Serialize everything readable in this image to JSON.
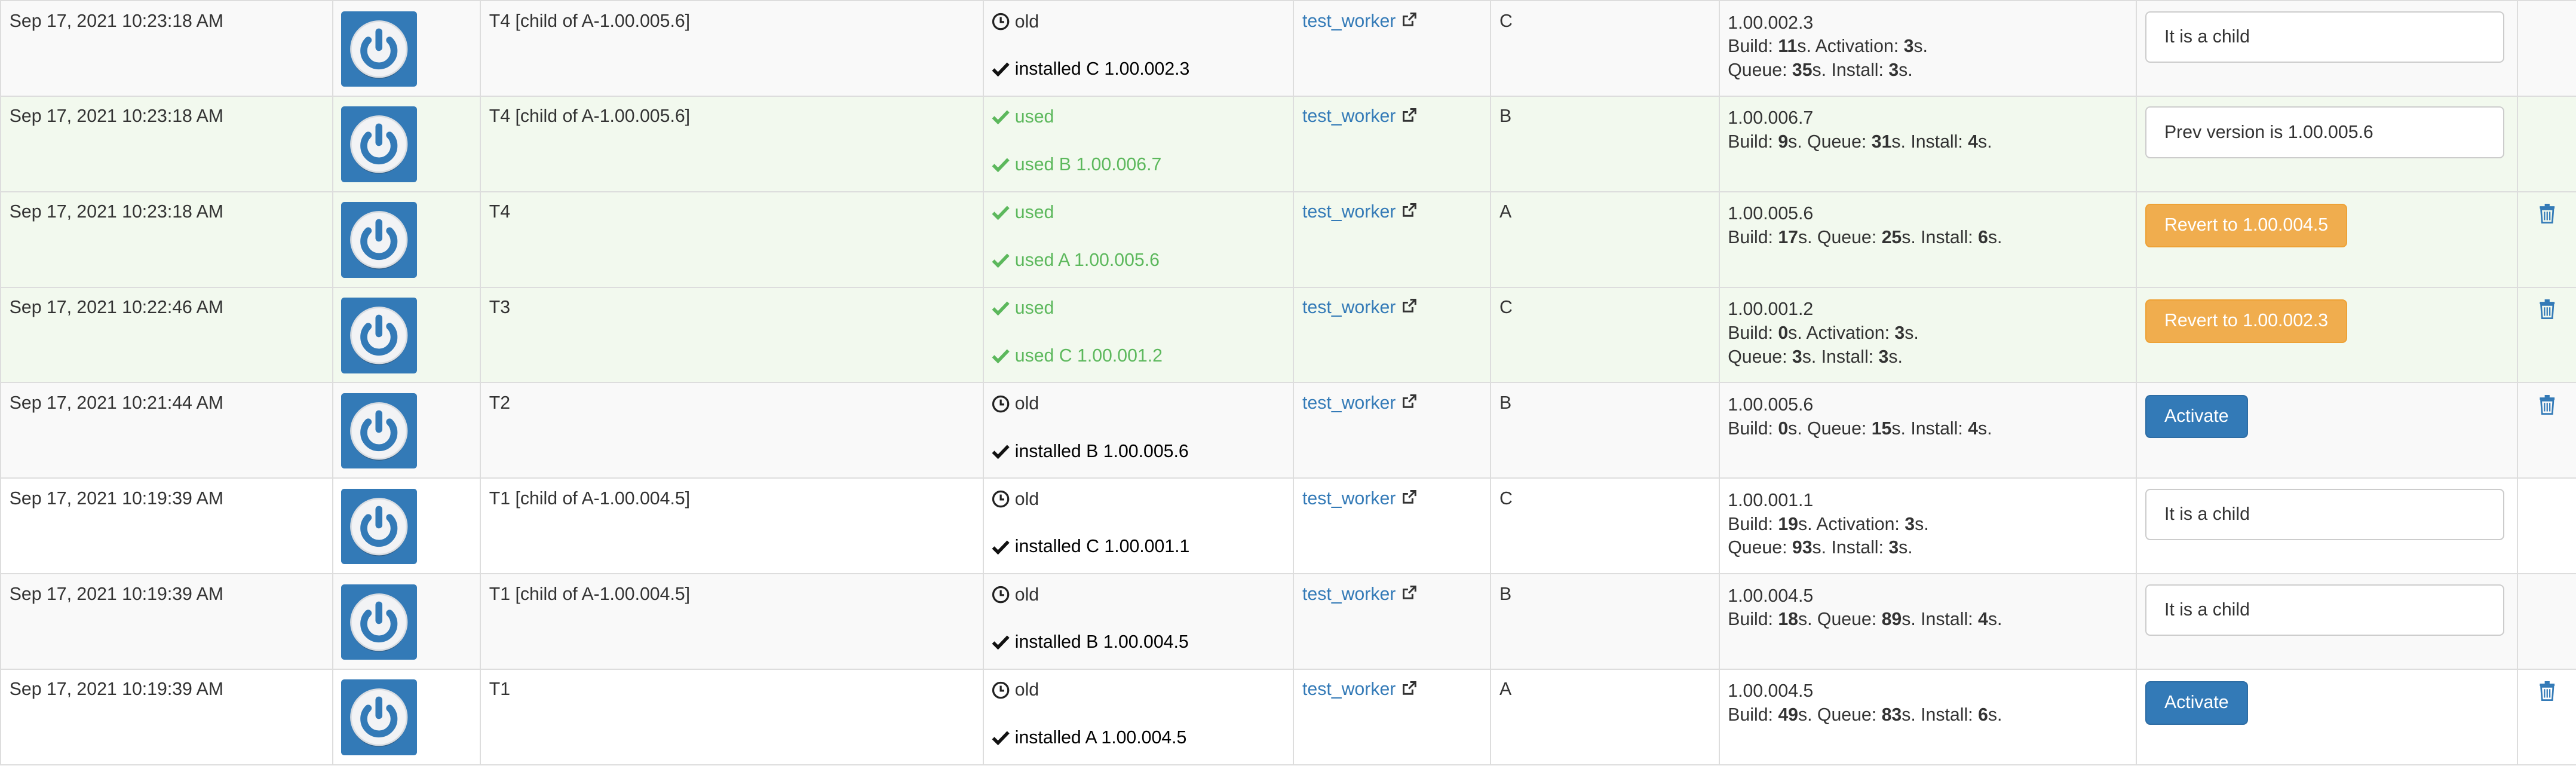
{
  "rows": [
    {
      "date": "Sep 17, 2021 10:23:18 AM",
      "name": "T4 [child of A-1.00.005.6]",
      "state": "old",
      "install_status": "installed C 1.00.002.3",
      "status_kind": "installed",
      "worker": "test_worker",
      "env": "C",
      "version": "1.00.002.3",
      "build": "11",
      "activation": "3",
      "queue": "35",
      "install": "3",
      "has_activation": true,
      "action": {
        "type": "note",
        "text": "It is a child"
      },
      "deletable": false,
      "highlight": "odd"
    },
    {
      "date": "Sep 17, 2021 10:23:18 AM",
      "name": "T4 [child of A-1.00.005.6]",
      "state": "used",
      "install_status": "used B 1.00.006.7",
      "status_kind": "used",
      "worker": "test_worker",
      "env": "B",
      "version": "1.00.006.7",
      "build": "9",
      "queue": "31",
      "install": "4",
      "has_activation": false,
      "action": {
        "type": "note",
        "text": "Prev version is 1.00.005.6"
      },
      "deletable": false,
      "highlight": "success"
    },
    {
      "date": "Sep 17, 2021 10:23:18 AM",
      "name": "T4",
      "state": "used",
      "install_status": "used A 1.00.005.6",
      "status_kind": "used",
      "worker": "test_worker",
      "env": "A",
      "version": "1.00.005.6",
      "build": "17",
      "queue": "25",
      "install": "6",
      "has_activation": false,
      "action": {
        "type": "revert",
        "text": "Revert to 1.00.004.5"
      },
      "deletable": true,
      "highlight": "success"
    },
    {
      "date": "Sep 17, 2021 10:22:46 AM",
      "name": "T3",
      "state": "used",
      "install_status": "used C 1.00.001.2",
      "status_kind": "used",
      "worker": "test_worker",
      "env": "C",
      "version": "1.00.001.2",
      "build": "0",
      "activation": "3",
      "queue": "3",
      "install": "3",
      "has_activation": true,
      "action": {
        "type": "revert",
        "text": "Revert to 1.00.002.3"
      },
      "deletable": true,
      "highlight": "success"
    },
    {
      "date": "Sep 17, 2021 10:21:44 AM",
      "name": "T2",
      "state": "old",
      "install_status": "installed B 1.00.005.6",
      "status_kind": "installed",
      "worker": "test_worker",
      "env": "B",
      "version": "1.00.005.6",
      "build": "0",
      "queue": "15",
      "install": "4",
      "has_activation": false,
      "action": {
        "type": "activate",
        "text": "Activate"
      },
      "deletable": true,
      "highlight": "odd"
    },
    {
      "date": "Sep 17, 2021 10:19:39 AM",
      "name": "T1 [child of A-1.00.004.5]",
      "state": "old",
      "install_status": "installed C 1.00.001.1",
      "status_kind": "installed",
      "worker": "test_worker",
      "env": "C",
      "version": "1.00.001.1",
      "build": "19",
      "activation": "3",
      "queue": "93",
      "install": "3",
      "has_activation": true,
      "action": {
        "type": "note",
        "text": "It is a child"
      },
      "deletable": false,
      "highlight": "even"
    },
    {
      "date": "Sep 17, 2021 10:19:39 AM",
      "name": "T1 [child of A-1.00.004.5]",
      "state": "old",
      "install_status": "installed B 1.00.004.5",
      "status_kind": "installed",
      "worker": "test_worker",
      "env": "B",
      "version": "1.00.004.5",
      "build": "18",
      "queue": "89",
      "install": "4",
      "has_activation": false,
      "action": {
        "type": "note",
        "text": "It is a child"
      },
      "deletable": false,
      "highlight": "odd"
    },
    {
      "date": "Sep 17, 2021 10:19:39 AM",
      "name": "T1",
      "state": "old",
      "install_status": "installed A 1.00.004.5",
      "status_kind": "installed",
      "worker": "test_worker",
      "env": "A",
      "version": "1.00.004.5",
      "build": "49",
      "queue": "83",
      "install": "6",
      "has_activation": false,
      "action": {
        "type": "activate",
        "text": "Activate"
      },
      "deletable": true,
      "highlight": "even"
    }
  ],
  "labels": {
    "build": "Build: ",
    "activation": "Activation: ",
    "queue": "Queue: ",
    "install": "Install: ",
    "seconds": "s."
  },
  "icons": {
    "app": "power-icon",
    "old": "clock-icon",
    "status": "check-icon",
    "external": "external-link-icon",
    "delete": "trash-icon"
  },
  "colors": {
    "link": "#337ab7",
    "success_text": "#5cb85c",
    "success_row": "#f2f9ee",
    "striped_row": "#f9f9f9",
    "warning_button": "#f0ad4e",
    "primary_button": "#337ab7",
    "app_tile": "#337ab7"
  }
}
